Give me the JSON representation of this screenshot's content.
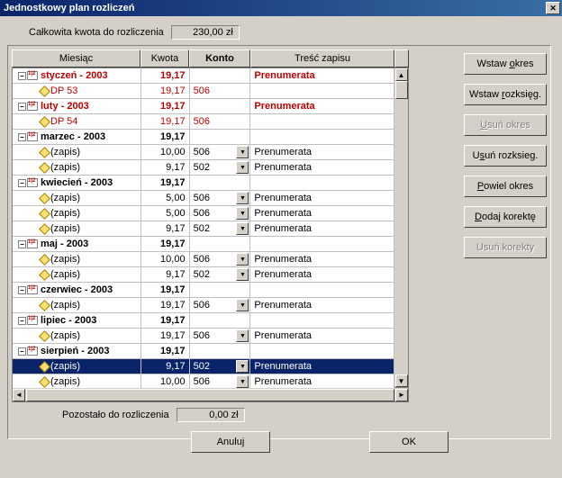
{
  "window": {
    "title": "Jednostkowy plan rozliczeń"
  },
  "top": {
    "label": "Całkowita kwota do rozliczenia",
    "value": "230,00 zł"
  },
  "headers": {
    "month": "Miesiąc",
    "amount": "Kwota",
    "account": "Konto",
    "desc": "Treść zapisu"
  },
  "rows": [
    {
      "type": "group",
      "label": "styczeń - 2003",
      "amount": "19,17",
      "account": "",
      "desc": "Prenumerata",
      "red": true
    },
    {
      "type": "leaf",
      "label": "DP 53",
      "amount": "19,17",
      "account": "506",
      "desc": "",
      "red": true
    },
    {
      "type": "group",
      "label": "luty - 2003",
      "amount": "19,17",
      "account": "",
      "desc": "Prenumerata",
      "red": true
    },
    {
      "type": "leaf",
      "label": "DP 54",
      "amount": "19,17",
      "account": "506",
      "desc": "",
      "red": true
    },
    {
      "type": "group",
      "label": "marzec - 2003",
      "amount": "19,17",
      "account": "",
      "desc": ""
    },
    {
      "type": "leaf",
      "label": "(zapis)",
      "amount": "10,00",
      "account": "506",
      "desc": "Prenumerata",
      "dd": true
    },
    {
      "type": "leaf",
      "label": "(zapis)",
      "amount": "9,17",
      "account": "502",
      "desc": "Prenumerata",
      "dd": true
    },
    {
      "type": "group",
      "label": "kwiecień - 2003",
      "amount": "19,17",
      "account": "",
      "desc": ""
    },
    {
      "type": "leaf",
      "label": "(zapis)",
      "amount": "5,00",
      "account": "506",
      "desc": "Prenumerata",
      "dd": true
    },
    {
      "type": "leaf",
      "label": "(zapis)",
      "amount": "5,00",
      "account": "506",
      "desc": "Prenumerata",
      "dd": true
    },
    {
      "type": "leaf",
      "label": "(zapis)",
      "amount": "9,17",
      "account": "502",
      "desc": "Prenumerata",
      "dd": true
    },
    {
      "type": "group",
      "label": "maj - 2003",
      "amount": "19,17",
      "account": "",
      "desc": ""
    },
    {
      "type": "leaf",
      "label": "(zapis)",
      "amount": "10,00",
      "account": "506",
      "desc": "Prenumerata",
      "dd": true
    },
    {
      "type": "leaf",
      "label": "(zapis)",
      "amount": "9,17",
      "account": "502",
      "desc": "Prenumerata",
      "dd": true
    },
    {
      "type": "group",
      "label": "czerwiec - 2003",
      "amount": "19,17",
      "account": "",
      "desc": ""
    },
    {
      "type": "leaf",
      "label": "(zapis)",
      "amount": "19,17",
      "account": "506",
      "desc": "Prenumerata",
      "dd": true
    },
    {
      "type": "group",
      "label": "lipiec - 2003",
      "amount": "19,17",
      "account": "",
      "desc": ""
    },
    {
      "type": "leaf",
      "label": "(zapis)",
      "amount": "19,17",
      "account": "506",
      "desc": "Prenumerata",
      "dd": true
    },
    {
      "type": "group",
      "label": "sierpień - 2003",
      "amount": "19,17",
      "account": "",
      "desc": ""
    },
    {
      "type": "leaf",
      "label": "(zapis)",
      "amount": "9,17",
      "account": "502",
      "desc": "Prenumerata",
      "dd": true,
      "sel": true
    },
    {
      "type": "leaf",
      "label": "(zapis)",
      "amount": "10,00",
      "account": "506",
      "desc": "Prenumerata",
      "dd": true
    }
  ],
  "side": {
    "insert_period": "Wstaw okres",
    "insert_post": "Wstaw rozksięg.",
    "del_period": "Usuń okres",
    "del_post": "Usuń rozksieg.",
    "dup_period": "Powiel okres",
    "add_corr": "Dodaj korektę",
    "del_corr": "Usuń korekty"
  },
  "bottom": {
    "label": "Pozostało do rozliczenia",
    "value": "0,00 zł"
  },
  "footer": {
    "cancel": "Anuluj",
    "ok": "OK"
  }
}
